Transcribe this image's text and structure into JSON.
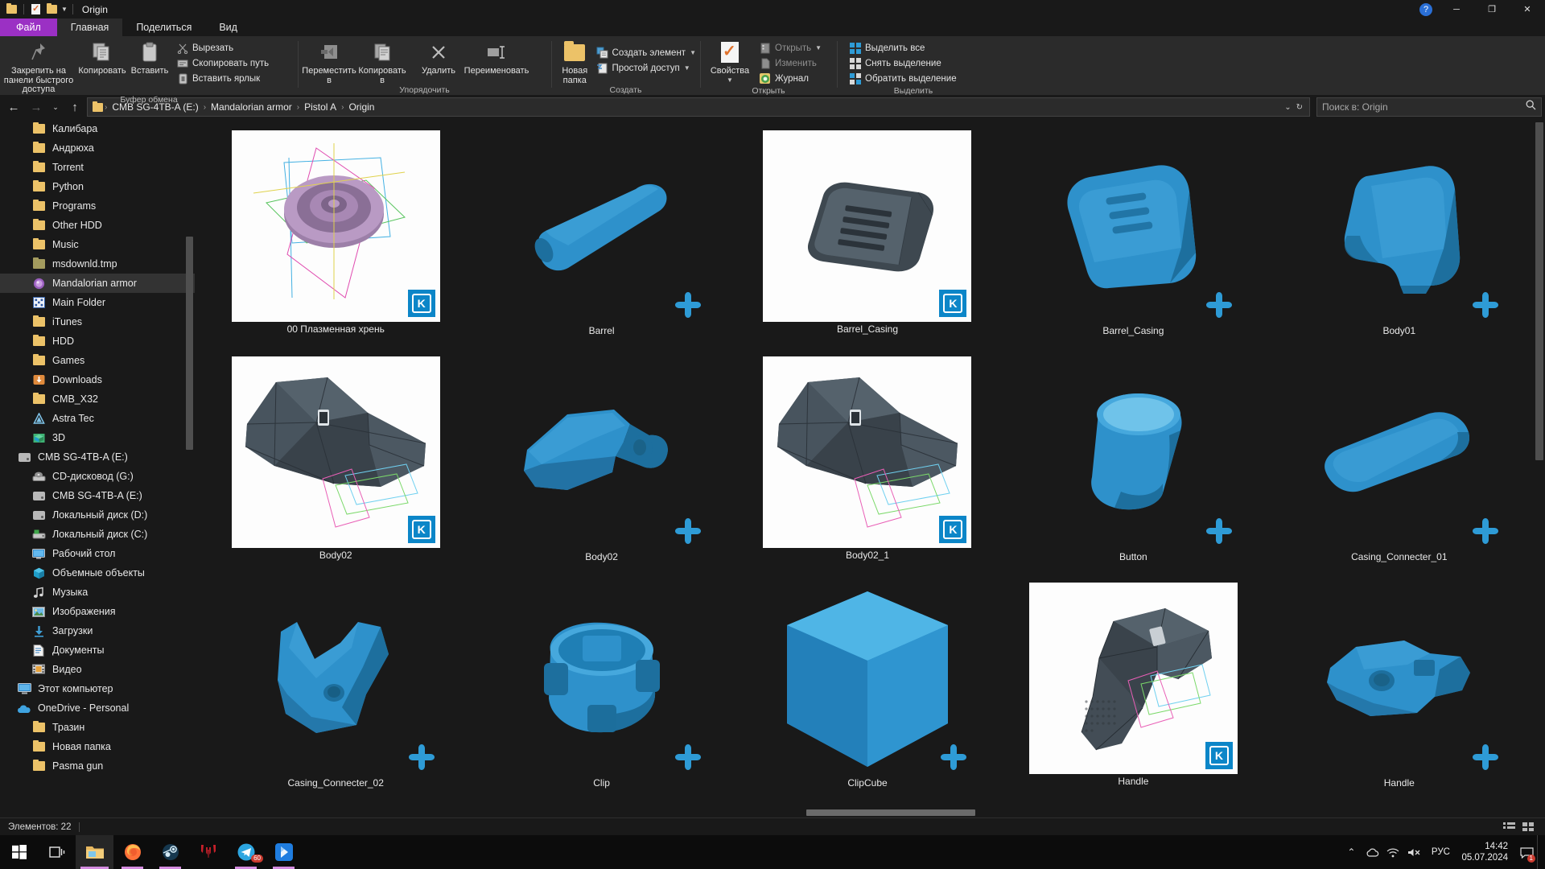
{
  "window": {
    "title": "Origin",
    "qat": {
      "new_folder_label": "new-folder",
      "properties_label": "properties",
      "customize_label": "customize"
    },
    "controls": {
      "minimize": "─",
      "maximize": "❐",
      "close": "✕",
      "help": "?"
    }
  },
  "tabs": [
    {
      "label": "Файл",
      "kind": "file"
    },
    {
      "label": "Главная",
      "kind": "active"
    },
    {
      "label": "Поделиться",
      "kind": "normal"
    },
    {
      "label": "Вид",
      "kind": "normal"
    }
  ],
  "ribbon": {
    "groups": [
      {
        "label": "Буфер обмена",
        "big": [
          {
            "label": "Закрепить на панели быстрого доступа",
            "icon": "pin-icon"
          },
          {
            "label": "Копировать",
            "icon": "copy-icon"
          },
          {
            "label": "Вставить",
            "icon": "paste-icon"
          }
        ],
        "small": [
          {
            "label": "Вырезать",
            "icon": "scissors-icon"
          },
          {
            "label": "Скопировать путь",
            "icon": "copy-path-icon"
          },
          {
            "label": "Вставить ярлык",
            "icon": "paste-shortcut-icon"
          }
        ]
      },
      {
        "label": "Упорядочить",
        "big": [
          {
            "label": "Переместить в",
            "icon": "move-to-icon",
            "caret": true
          },
          {
            "label": "Копировать в",
            "icon": "copy-to-icon",
            "caret": true
          },
          {
            "label": "Удалить",
            "icon": "delete-icon",
            "caret": true
          },
          {
            "label": "Переименовать",
            "icon": "rename-icon"
          }
        ],
        "small": []
      },
      {
        "label": "Создать",
        "big": [
          {
            "label": "Новая папка",
            "icon": "new-folder-icon"
          }
        ],
        "small": [
          {
            "label": "Создать элемент",
            "icon": "new-item-icon",
            "caret": true
          },
          {
            "label": "Простой доступ",
            "icon": "easy-access-icon",
            "caret": true
          }
        ]
      },
      {
        "label": "Открыть",
        "big": [
          {
            "label": "Свойства",
            "icon": "properties-icon",
            "caret": true
          }
        ],
        "small": [
          {
            "label": "Открыть",
            "icon": "open-icon",
            "caret": true,
            "dim": true
          },
          {
            "label": "Изменить",
            "icon": "edit-icon",
            "dim": true
          },
          {
            "label": "Журнал",
            "icon": "history-icon"
          }
        ]
      },
      {
        "label": "Выделить",
        "big": [],
        "small": [
          {
            "label": "Выделить все",
            "icon": "select-all-icon"
          },
          {
            "label": "Снять выделение",
            "icon": "select-none-icon"
          },
          {
            "label": "Обратить выделение",
            "icon": "invert-selection-icon"
          }
        ]
      }
    ]
  },
  "addressbar": {
    "back": "←",
    "forward": "→",
    "recent": "⌄",
    "up": "↑",
    "crumbs": [
      "CMB SG-4TB-A (E:)",
      "Mandalorian armor",
      "Pistol A",
      "Origin"
    ],
    "separator": "›",
    "dropdown": "⌄",
    "refresh": "↻",
    "search_placeholder": "Поиск в: Origin",
    "search_value": ""
  },
  "sidebar": {
    "items": [
      {
        "label": "Pasma gun",
        "icon": "folder-icon",
        "indent": 2
      },
      {
        "label": "Новая папка",
        "icon": "folder-icon",
        "indent": 2
      },
      {
        "label": "Тразин",
        "icon": "folder-icon",
        "indent": 2
      },
      {
        "label": "OneDrive - Personal",
        "icon": "onedrive-icon",
        "indent": 1
      },
      {
        "label": "Этот компьютер",
        "icon": "this-pc-icon",
        "indent": 1
      },
      {
        "label": "Видео",
        "icon": "videos-icon",
        "indent": 2
      },
      {
        "label": "Документы",
        "icon": "documents-icon",
        "indent": 2
      },
      {
        "label": "Загрузки",
        "icon": "downloads-icon",
        "indent": 2
      },
      {
        "label": "Изображения",
        "icon": "pictures-icon",
        "indent": 2
      },
      {
        "label": "Музыка",
        "icon": "music-icon",
        "indent": 2
      },
      {
        "label": "Объемные объекты",
        "icon": "3d-objects-icon",
        "indent": 2
      },
      {
        "label": "Рабочий стол",
        "icon": "desktop-icon",
        "indent": 2
      },
      {
        "label": "Локальный диск (C:)",
        "icon": "system-drive-icon",
        "indent": 2
      },
      {
        "label": "Локальный диск (D:)",
        "icon": "drive-icon",
        "indent": 2
      },
      {
        "label": "CMB SG-4TB-A (E:)",
        "icon": "drive-icon",
        "indent": 2
      },
      {
        "label": "CD-дисковод (G:)",
        "icon": "cd-drive-icon",
        "indent": 2
      },
      {
        "label": "CMB SG-4TB-A (E:)",
        "icon": "drive-icon",
        "indent": 1
      },
      {
        "label": "3D",
        "icon": "3d-folder-icon",
        "indent": 2
      },
      {
        "label": "Astra Tec",
        "icon": "astra-tec-icon",
        "indent": 2
      },
      {
        "label": "CMB_X32",
        "icon": "folder-icon",
        "indent": 2
      },
      {
        "label": "Downloads",
        "icon": "downloads-folder-icon",
        "indent": 2
      },
      {
        "label": "Games",
        "icon": "folder-icon",
        "indent": 2
      },
      {
        "label": "HDD",
        "icon": "folder-icon",
        "indent": 2
      },
      {
        "label": "iTunes",
        "icon": "folder-icon",
        "indent": 2
      },
      {
        "label": "Main Folder",
        "icon": "main-folder-icon",
        "indent": 2
      },
      {
        "label": "Mandalorian armor",
        "icon": "mandalorian-icon",
        "indent": 2,
        "selected": true
      },
      {
        "label": "msdownld.tmp",
        "icon": "folder-olive-icon",
        "indent": 2
      },
      {
        "label": "Music",
        "icon": "folder-icon",
        "indent": 2
      },
      {
        "label": "Other HDD",
        "icon": "folder-icon",
        "indent": 2
      },
      {
        "label": "Programs",
        "icon": "folder-icon",
        "indent": 2
      },
      {
        "label": "Python",
        "icon": "folder-icon",
        "indent": 2
      },
      {
        "label": "Torrent",
        "icon": "folder-icon",
        "indent": 2
      },
      {
        "label": "Андрюха",
        "icon": "folder-icon",
        "indent": 2
      },
      {
        "label": "Калибара",
        "icon": "folder-icon",
        "indent": 2
      }
    ]
  },
  "files": [
    {
      "name": "00 Плазменная хрень",
      "thumb": "white",
      "model": "plasma-dial",
      "badge": "kompas"
    },
    {
      "name": "Barrel",
      "thumb": "dark",
      "model": "barrel",
      "badge": "stl"
    },
    {
      "name": "Barrel_Casing",
      "thumb": "white",
      "model": "casing-dark",
      "badge": "kompas"
    },
    {
      "name": "Barrel_Casing",
      "thumb": "dark",
      "model": "casing-blue",
      "badge": "stl"
    },
    {
      "name": "Body01",
      "thumb": "dark",
      "model": "body01",
      "badge": "stl"
    },
    {
      "name": "Body02",
      "thumb": "white",
      "model": "body-dark",
      "badge": "kompas"
    },
    {
      "name": "Body02",
      "thumb": "dark",
      "model": "body02-blue",
      "badge": "stl"
    },
    {
      "name": "Body02_1",
      "thumb": "white",
      "model": "body-dark",
      "badge": "kompas"
    },
    {
      "name": "Button",
      "thumb": "dark",
      "model": "button",
      "badge": "stl"
    },
    {
      "name": "Casing_Connecter_01",
      "thumb": "dark",
      "model": "connector01",
      "badge": "stl"
    },
    {
      "name": "Casing_Connecter_02",
      "thumb": "dark",
      "model": "connector02",
      "badge": "stl"
    },
    {
      "name": "Clip",
      "thumb": "dark",
      "model": "clip",
      "badge": "stl"
    },
    {
      "name": "ClipCube",
      "thumb": "dark",
      "model": "cube",
      "badge": "stl"
    },
    {
      "name": "Handle",
      "thumb": "white",
      "model": "handle-dark",
      "badge": "kompas"
    },
    {
      "name": "Handle",
      "thumb": "dark",
      "model": "handle-blue",
      "badge": "stl"
    }
  ],
  "statusbar": {
    "items_label": "Элементов: 22",
    "view_icons": "list-view-icon",
    "view_tiles": "tile-view-icon"
  },
  "taskbar": {
    "start": "start-icon",
    "taskview": "task-view-icon",
    "apps": [
      {
        "name": "file-explorer-icon",
        "active": true
      },
      {
        "name": "firefox-icon",
        "active": false,
        "underline": true
      },
      {
        "name": "steam-icon",
        "active": false,
        "underline": true
      },
      {
        "name": "predator-icon",
        "active": false,
        "underline": false
      },
      {
        "name": "telegram-icon",
        "active": false,
        "underline": true,
        "badge": "60"
      },
      {
        "name": "media-player-icon",
        "active": false,
        "underline": true
      }
    ],
    "tray": {
      "chevron": "⌃",
      "cloud": "cloud-icon",
      "network": "network-icon",
      "volume": "volume-muted-icon",
      "language": "РУС",
      "time": "14:42",
      "date": "05.07.2024",
      "notifications": "notification-icon"
    }
  },
  "colors": {
    "accent": "#2e9bd6",
    "model_blue": "#2e91cb",
    "file_tab": "#9b30c4",
    "folder_yellow": "#ecc268",
    "bg": "#191919",
    "ribbon_bg": "#2b2b2b"
  }
}
